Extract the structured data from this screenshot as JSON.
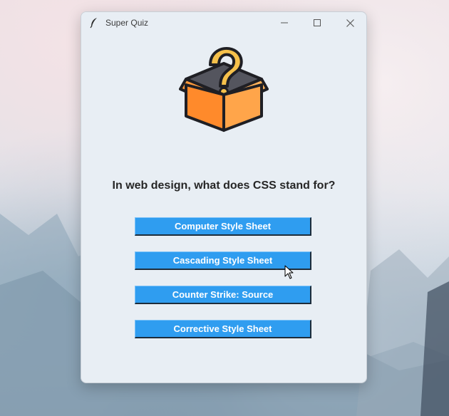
{
  "window": {
    "title": "Super Quiz",
    "controls": [
      "minimize-icon",
      "maximize-icon",
      "close-icon"
    ]
  },
  "quiz": {
    "image_icon": "question-box-icon",
    "question": "In web design, what does CSS stand for?",
    "answers": [
      "Computer Style Sheet",
      "Cascading Style Sheet",
      "Counter Strike: Source",
      "Corrective Style Sheet"
    ]
  },
  "colors": {
    "button_bg": "#2f9df0",
    "button_text": "#ffffff",
    "window_bg": "#e8eef4",
    "question_text": "#262626",
    "box_orange": "#ff9a3c",
    "box_dark": "#54555e",
    "question_mark": "#f6c14b"
  }
}
